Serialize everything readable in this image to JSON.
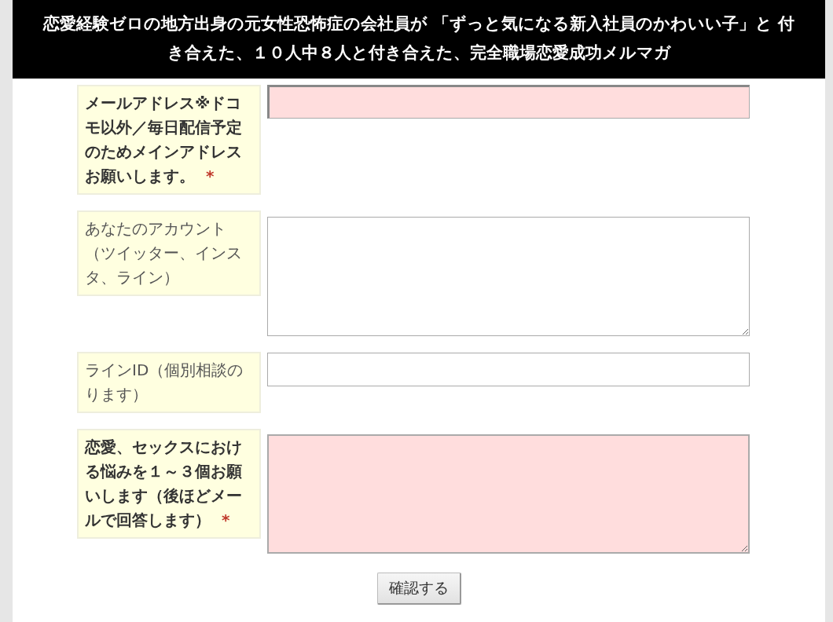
{
  "header": {
    "title": "恋愛経験ゼロの地方出身の元女性恐怖症の会社員が 「ずっと気になる新入社員のかわいい子」と 付き合えた、１０人中８人と付き合えた、完全職場恋愛成功メルマガ"
  },
  "fields": [
    {
      "label": "メールアドレス※ドコモ以外／毎日配信予定のためメインアドレスお願いします。",
      "required": true,
      "required_mark": "*",
      "kind": "input"
    },
    {
      "label": "あなたのアカウント（ツイッター、インスタ、ライン）",
      "required": false,
      "kind": "textarea"
    },
    {
      "label": "ラインID（個別相談のります）",
      "required": false,
      "kind": "input"
    },
    {
      "label": "恋愛、セックスにおける悩みを１～３個お願いします（後ほどメールで回答します）",
      "required": true,
      "required_mark": "*",
      "kind": "textarea"
    }
  ],
  "submit": {
    "label": "確認する"
  }
}
